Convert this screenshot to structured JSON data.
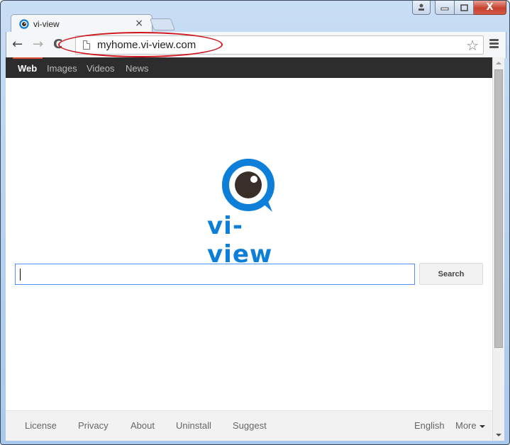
{
  "window": {
    "controls": {
      "profile": "profile-icon",
      "minimize": "minimize-icon",
      "maximize": "maximize-icon",
      "close": "close-icon",
      "close_glyph": "X"
    }
  },
  "tab": {
    "title": "vi-view",
    "close_glyph": "×",
    "icon": "vi-view-favicon"
  },
  "toolbar": {
    "back_glyph": "←",
    "forward_glyph": "→",
    "reload_glyph": "C",
    "url": "myhome.vi-view.com",
    "star_glyph": "☆"
  },
  "topnav": {
    "items": [
      {
        "label": "Web",
        "active": true
      },
      {
        "label": "Images",
        "active": false
      },
      {
        "label": "Videos",
        "active": false
      },
      {
        "label": "News",
        "active": false
      }
    ]
  },
  "logo": {
    "text": "vi-view",
    "brand_color": "#0d7fd8",
    "pupil_color": "#3a2e28"
  },
  "search": {
    "value": "",
    "button_label": "Search"
  },
  "footer": {
    "links": [
      "License",
      "Privacy",
      "About",
      "Uninstall",
      "Suggest"
    ],
    "language": "English",
    "more_label": "More"
  },
  "annotation": {
    "highlight_color": "#d0121b"
  }
}
